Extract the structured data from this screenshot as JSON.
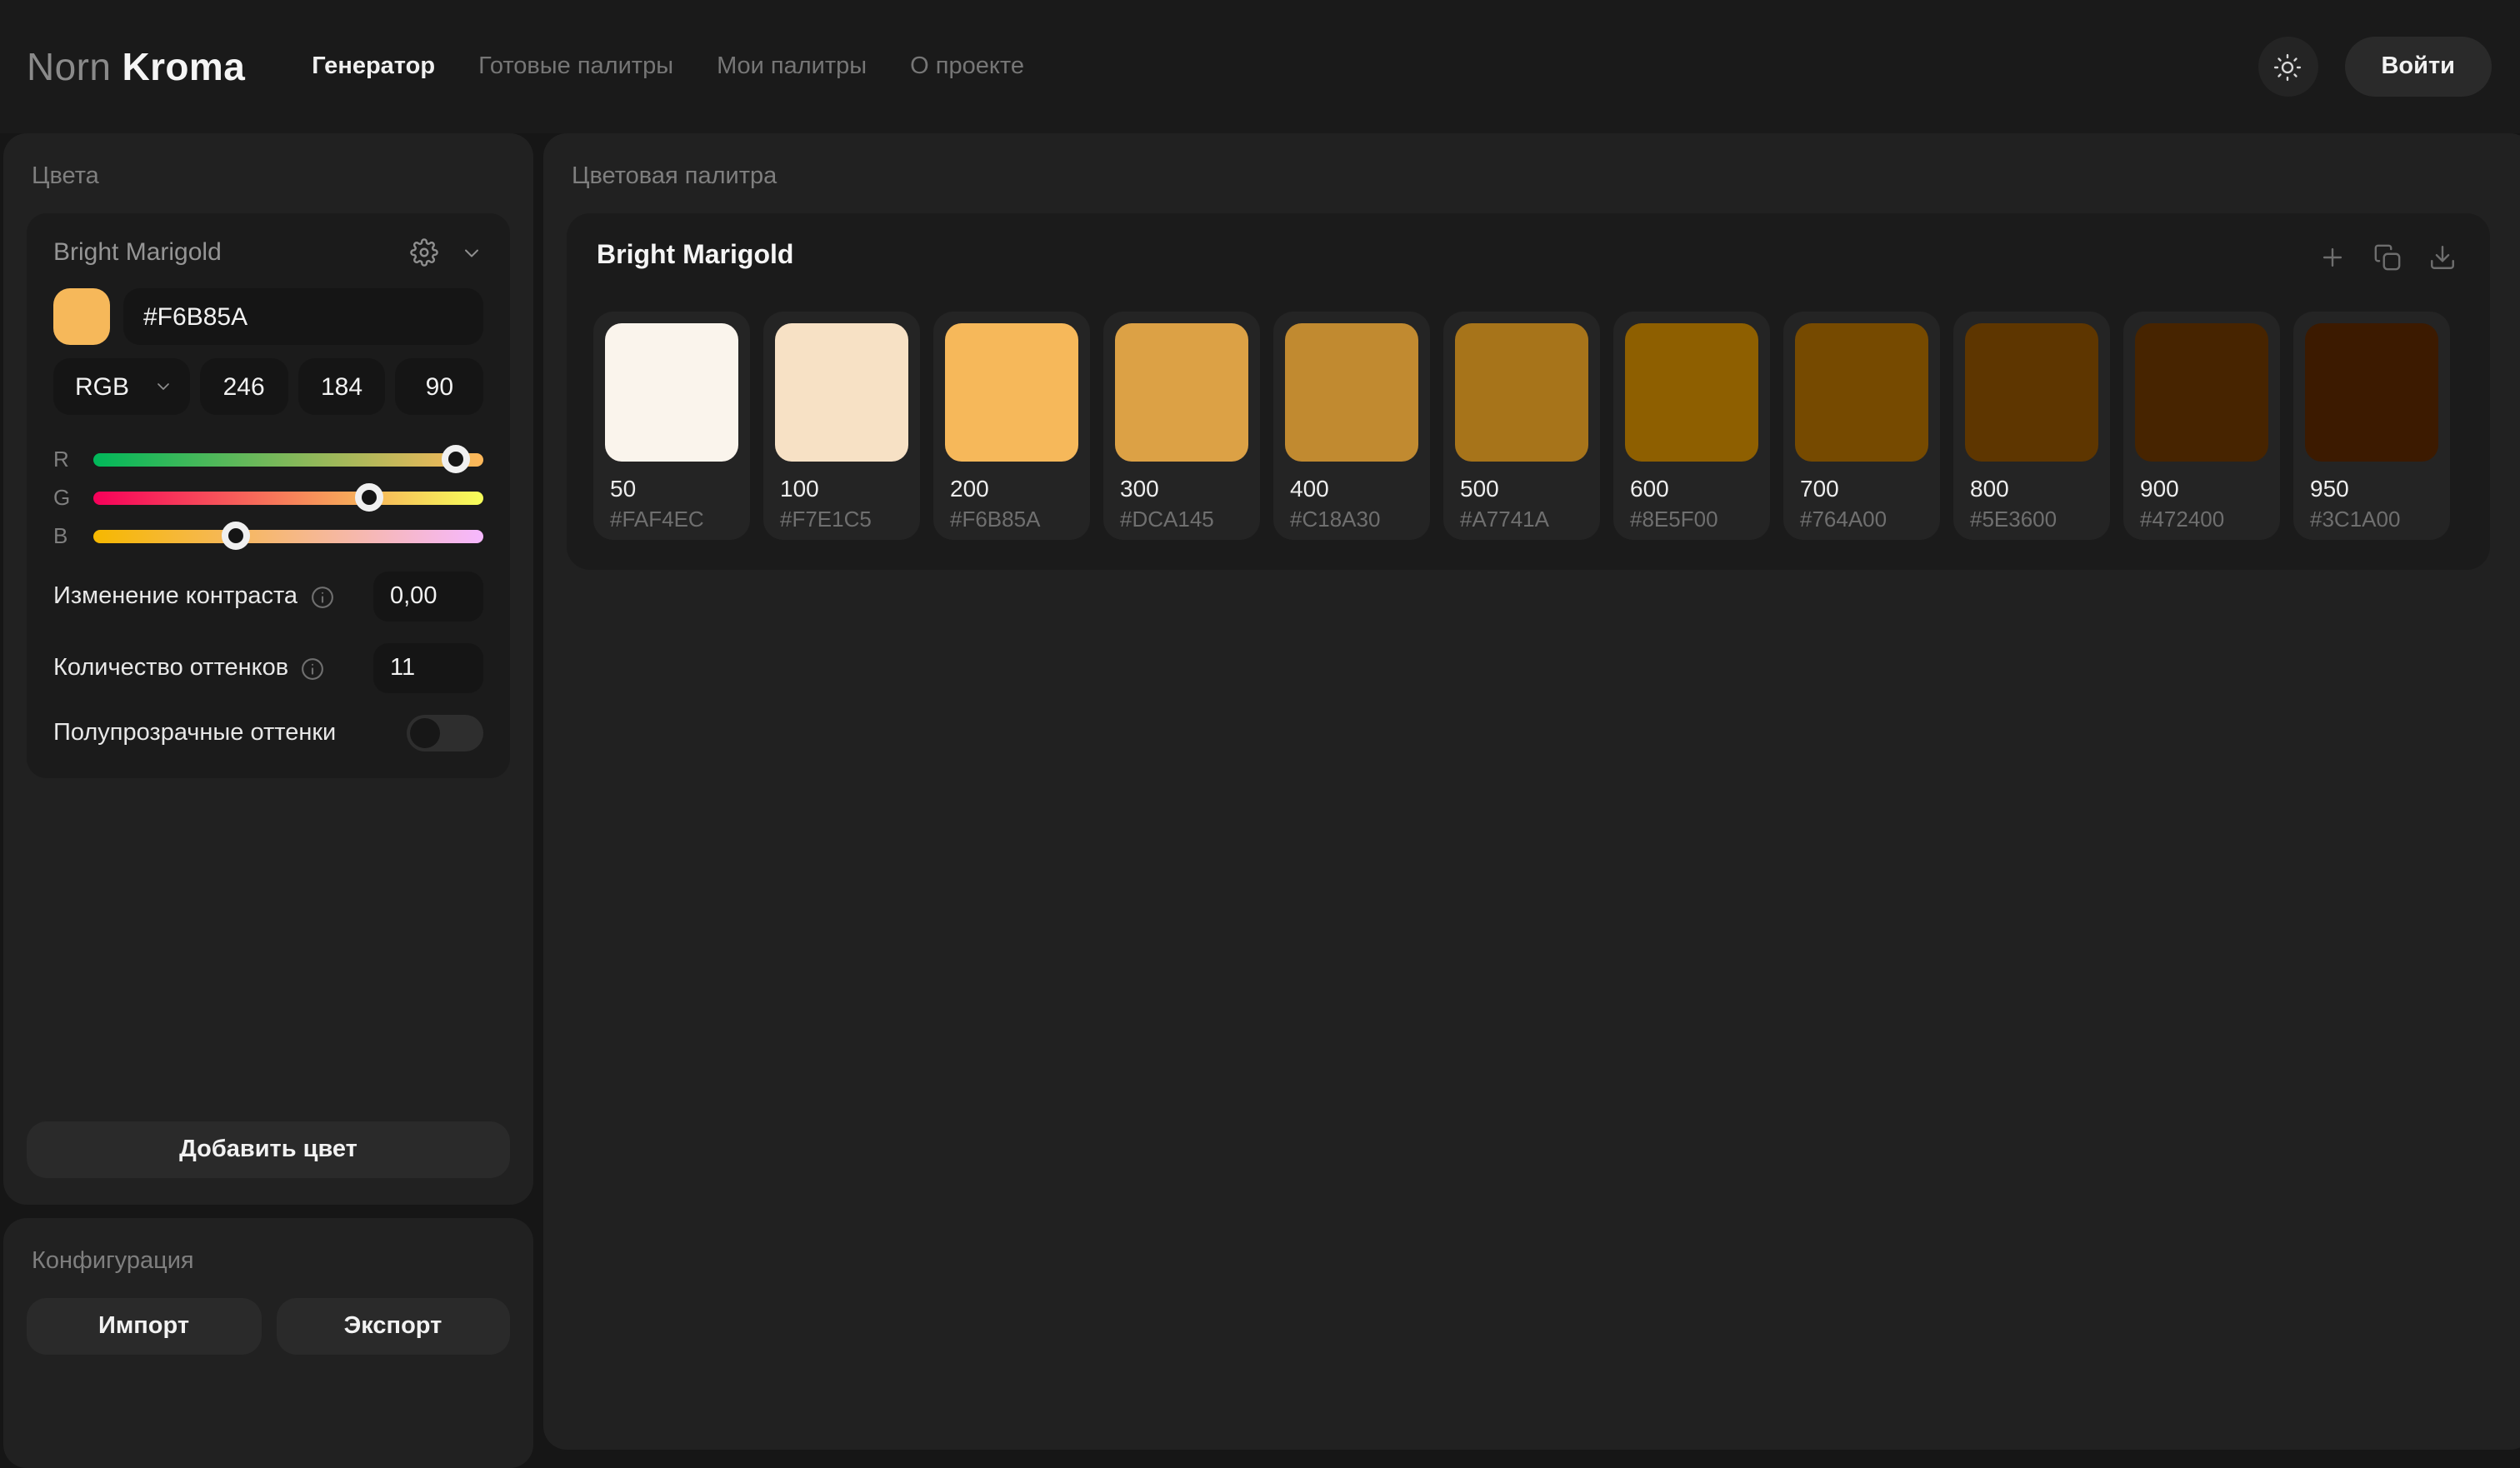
{
  "header": {
    "logo_part1": "Norn",
    "logo_part2": "Kroma",
    "nav": [
      {
        "label": "Генератор",
        "active": true
      },
      {
        "label": "Готовые палитры",
        "active": false
      },
      {
        "label": "Мои палитры",
        "active": false
      },
      {
        "label": "О проекте",
        "active": false
      }
    ],
    "theme_icon": "sun-icon",
    "login_label": "Войти"
  },
  "sidebar": {
    "colors_section_title": "Цвета",
    "color_card": {
      "name": "Bright Marigold",
      "hex": "#F6B85A",
      "mode": "RGB",
      "rgb_values": [
        "246",
        "184",
        "90"
      ],
      "sliders": [
        {
          "channel": "R",
          "value": 246,
          "max": 255,
          "track_from": "#00B85A",
          "track_to": "#FFB85A"
        },
        {
          "channel": "G",
          "value": 184,
          "max": 255,
          "track_from": "#F6005A",
          "track_to": "#F6FF5A"
        },
        {
          "channel": "B",
          "value": 90,
          "max": 255,
          "track_from": "#F6B800",
          "track_to": "#F6B8FF"
        }
      ],
      "contrast_label": "Изменение контраста",
      "contrast_value": "0,00",
      "shades_count_label": "Количество оттенков",
      "shades_count_value": "11",
      "translucent_label": "Полупрозрачные оттенки",
      "translucent_on": false
    },
    "add_color_label": "Добавить цвет",
    "config_section_title": "Конфигурация",
    "import_label": "Импорт",
    "export_label": "Экспорт"
  },
  "main": {
    "section_title": "Цветовая палитра",
    "palette": {
      "name": "Bright Marigold",
      "actions": [
        "plus-icon",
        "copy-icon",
        "download-icon"
      ],
      "shades": [
        {
          "label": "50",
          "hex": "#FAF4EC"
        },
        {
          "label": "100",
          "hex": "#F7E1C5"
        },
        {
          "label": "200",
          "hex": "#F6B85A"
        },
        {
          "label": "300",
          "hex": "#DCA145"
        },
        {
          "label": "400",
          "hex": "#C18A30"
        },
        {
          "label": "500",
          "hex": "#A7741A"
        },
        {
          "label": "600",
          "hex": "#8E5F00"
        },
        {
          "label": "700",
          "hex": "#764A00"
        },
        {
          "label": "800",
          "hex": "#5E3600"
        },
        {
          "label": "900",
          "hex": "#472400"
        },
        {
          "label": "950",
          "hex": "#3C1A00"
        }
      ]
    }
  },
  "colors": {
    "accent": "#F6B85A",
    "page_bg": "#161616",
    "panel_bg": "#212121",
    "card_bg": "#1B1B1B"
  }
}
